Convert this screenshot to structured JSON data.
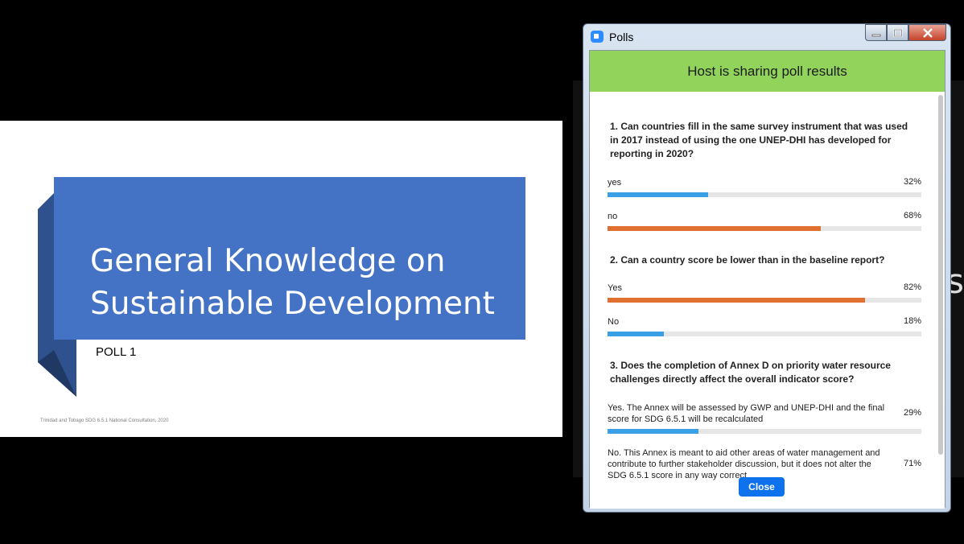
{
  "slide": {
    "title_line1": "General Knowledge on",
    "title_line2": "Sustainable Development",
    "poll_label": "POLL 1",
    "footer": "Trinidad and Tobago SDG 6.5.1 National Consultation, 2020"
  },
  "background_window": {
    "visible_text": "s"
  },
  "polls_window": {
    "title": "Polls",
    "controls": {
      "minimize": "minimize-icon",
      "maximize": "maximize-icon",
      "close": "close-icon"
    },
    "banner": "Host is sharing poll results",
    "questions": [
      {
        "text": "1. Can countries fill in the same survey instrument that was used in 2017 instead of using the one UNEP-DHI has developed for reporting in 2020?",
        "options": [
          {
            "label": "yes",
            "percent_label": "32%",
            "percent": 32,
            "color": "#3aa0e6"
          },
          {
            "label": "no",
            "percent_label": "68%",
            "percent": 68,
            "color": "#e07030"
          }
        ]
      },
      {
        "text": "2. Can a country score be lower than in the baseline report?",
        "options": [
          {
            "label": "Yes",
            "percent_label": "82%",
            "percent": 82,
            "color": "#e07030"
          },
          {
            "label": "No",
            "percent_label": "18%",
            "percent": 18,
            "color": "#3aa0e6"
          }
        ]
      },
      {
        "text": "3. Does the completion of Annex D on priority water resource challenges directly affect the overall indicator score?",
        "options": [
          {
            "label": "Yes. The Annex will be assessed by GWP and UNEP-DHI and the final score for SDG 6.5.1 will be recalculated",
            "percent_label": "29%",
            "percent": 29,
            "color": "#3aa0e6"
          },
          {
            "label": "No. This Annex is meant to aid other areas of water management and contribute to further stakeholder discussion, but it does not alter the SDG 6.5.1 score in any way correct",
            "percent_label": "71%",
            "percent": 71,
            "color": "#e07030"
          }
        ]
      }
    ],
    "close_label": "Close"
  }
}
